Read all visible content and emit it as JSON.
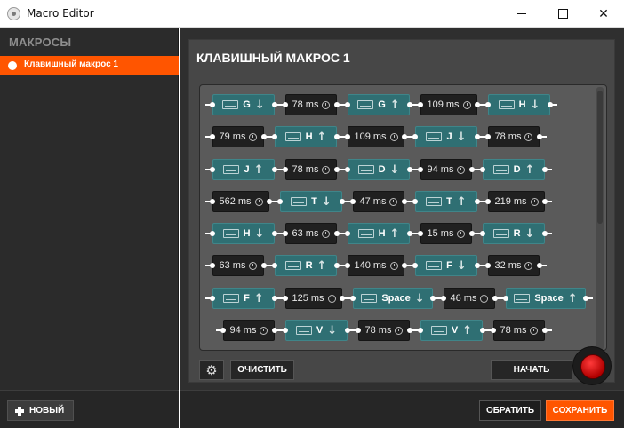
{
  "window": {
    "title": "Macro Editor"
  },
  "sidebar": {
    "header": "МАКРОСЫ",
    "items": [
      {
        "label": "Клавишный макрос 1"
      }
    ],
    "new_label": "НОВЫЙ"
  },
  "editor": {
    "title": "КЛАВИШНЫЙ МАКРОС 1",
    "clear_label": "ОЧИСТИТЬ",
    "start_label": "НАЧАТЬ",
    "revert_label": "ОБРАТИТЬ",
    "save_label": "СОХРАНИТЬ",
    "rows": [
      [
        {
          "t": "key",
          "k": "G",
          "d": "down"
        },
        {
          "t": "delay",
          "v": "78 ms"
        },
        {
          "t": "key",
          "k": "G",
          "d": "up"
        },
        {
          "t": "delay",
          "v": "109 ms"
        },
        {
          "t": "key",
          "k": "H",
          "d": "down"
        }
      ],
      [
        {
          "t": "delay",
          "v": "79 ms"
        },
        {
          "t": "key",
          "k": "H",
          "d": "up"
        },
        {
          "t": "delay",
          "v": "109 ms"
        },
        {
          "t": "key",
          "k": "J",
          "d": "down"
        },
        {
          "t": "delay",
          "v": "78 ms"
        }
      ],
      [
        {
          "t": "key",
          "k": "J",
          "d": "up"
        },
        {
          "t": "delay",
          "v": "78 ms"
        },
        {
          "t": "key",
          "k": "D",
          "d": "down"
        },
        {
          "t": "delay",
          "v": "94 ms"
        },
        {
          "t": "key",
          "k": "D",
          "d": "up"
        }
      ],
      [
        {
          "t": "delay",
          "v": "562 ms"
        },
        {
          "t": "key",
          "k": "T",
          "d": "down"
        },
        {
          "t": "delay",
          "v": "47 ms"
        },
        {
          "t": "key",
          "k": "T",
          "d": "up"
        },
        {
          "t": "delay",
          "v": "219 ms"
        }
      ],
      [
        {
          "t": "key",
          "k": "H",
          "d": "down"
        },
        {
          "t": "delay",
          "v": "63 ms"
        },
        {
          "t": "key",
          "k": "H",
          "d": "up"
        },
        {
          "t": "delay",
          "v": "15 ms"
        },
        {
          "t": "key",
          "k": "R",
          "d": "down"
        }
      ],
      [
        {
          "t": "delay",
          "v": "63 ms"
        },
        {
          "t": "key",
          "k": "R",
          "d": "up"
        },
        {
          "t": "delay",
          "v": "140 ms"
        },
        {
          "t": "key",
          "k": "F",
          "d": "down"
        },
        {
          "t": "delay",
          "v": "32 ms"
        }
      ],
      [
        {
          "t": "key",
          "k": "F",
          "d": "up"
        },
        {
          "t": "delay",
          "v": "125 ms"
        },
        {
          "t": "key",
          "k": "Space",
          "d": "down"
        },
        {
          "t": "delay",
          "v": "46 ms"
        },
        {
          "t": "key",
          "k": "Space",
          "d": "up"
        }
      ],
      [
        {
          "t": "delay",
          "v": "94 ms"
        },
        {
          "t": "key",
          "k": "V",
          "d": "down"
        },
        {
          "t": "delay",
          "v": "78 ms"
        },
        {
          "t": "key",
          "k": "V",
          "d": "up"
        },
        {
          "t": "delay",
          "v": "78 ms"
        }
      ]
    ]
  },
  "colors": {
    "accent": "#ff5500",
    "key_block": "#2f6f73",
    "delay_block": "#202020",
    "record": "#d00000"
  }
}
